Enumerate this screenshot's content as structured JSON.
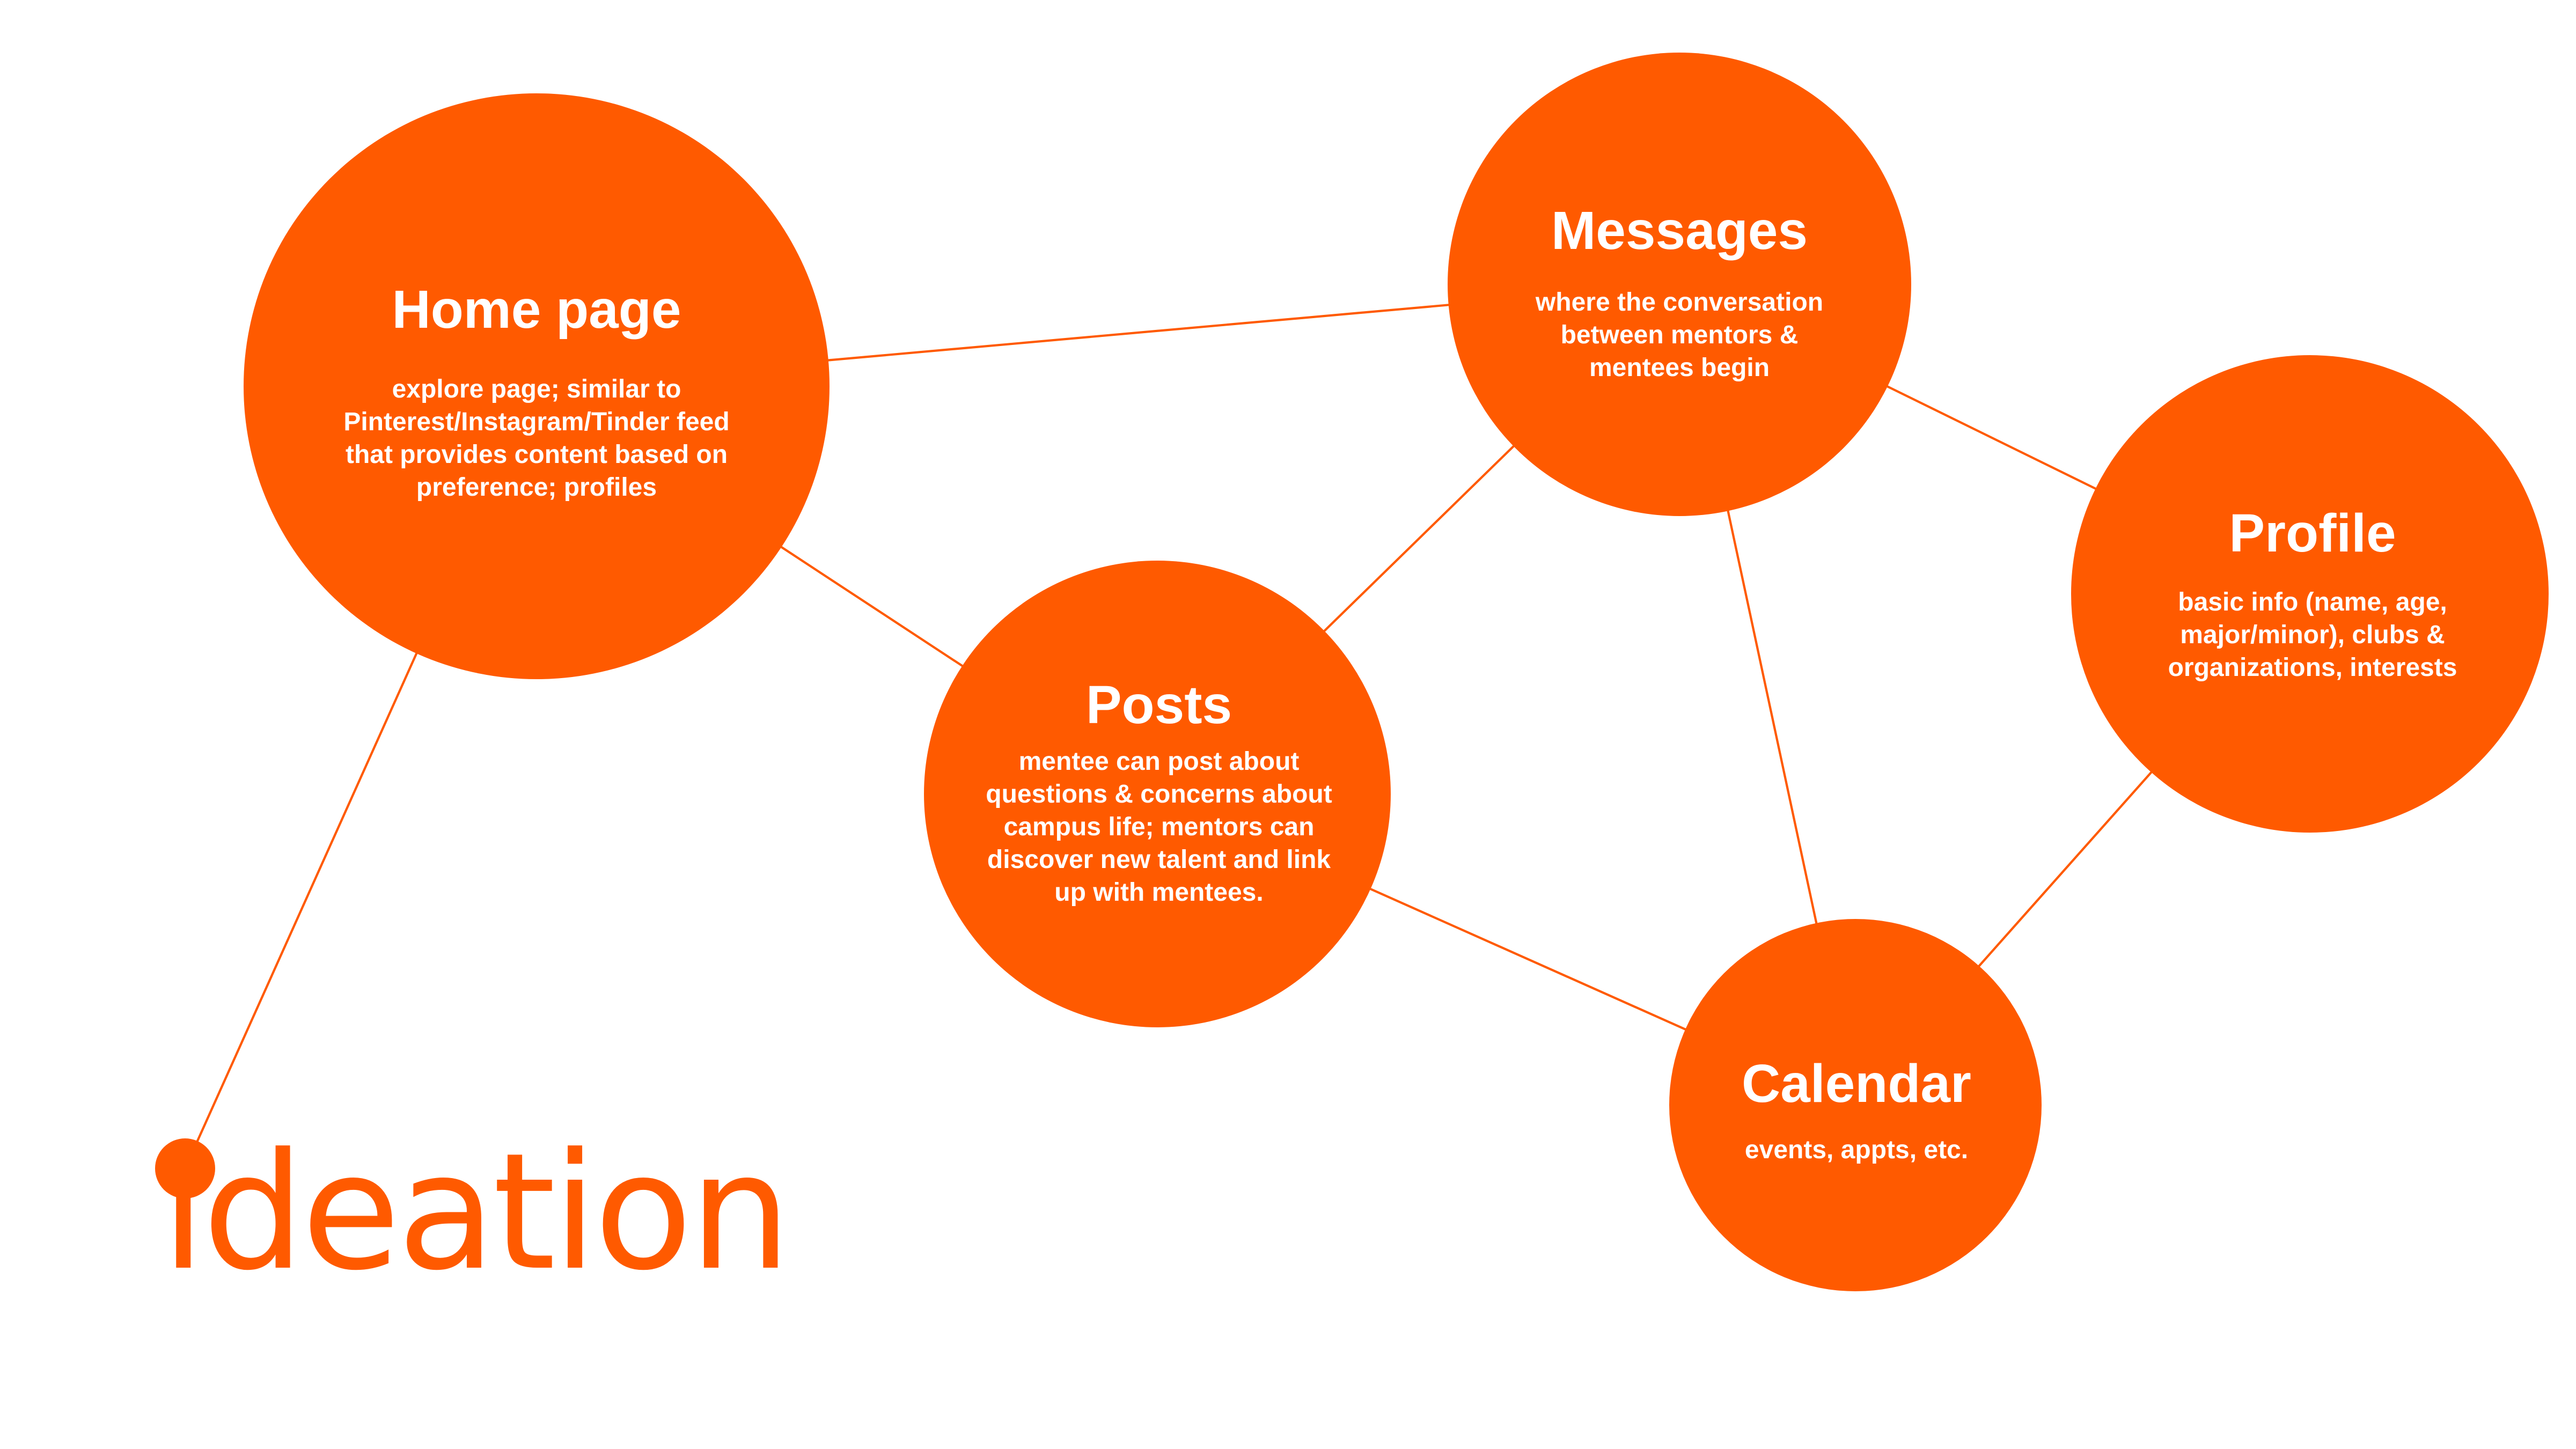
{
  "brand": {
    "wordmark": "ideation",
    "accent_color": "#FF5A00"
  },
  "nodes": {
    "home": {
      "title": "Home page",
      "description": "explore page; similar to\nPinterest/Instagram/Tinder feed\nthat provides content based on\npreference; profiles"
    },
    "messages": {
      "title": "Messages",
      "description": "where the conversation\nbetween mentors &\nmentees begin"
    },
    "profile": {
      "title": "Profile",
      "description": "basic info (name, age,\nmajor/minor), clubs &\norganizations, interests"
    },
    "posts": {
      "title": "Posts",
      "description": "mentee can post about\nquestions & concerns about\ncampus life; mentors can\ndiscover new talent and link\nup with mentees."
    },
    "calendar": {
      "title": "Calendar",
      "description": "events, appts, etc."
    }
  },
  "links": [
    [
      "home",
      "messages"
    ],
    [
      "home",
      "posts"
    ],
    [
      "home",
      "logo"
    ],
    [
      "messages",
      "posts"
    ],
    [
      "messages",
      "profile"
    ],
    [
      "messages",
      "calendar"
    ],
    [
      "posts",
      "calendar"
    ],
    [
      "profile",
      "calendar"
    ]
  ]
}
